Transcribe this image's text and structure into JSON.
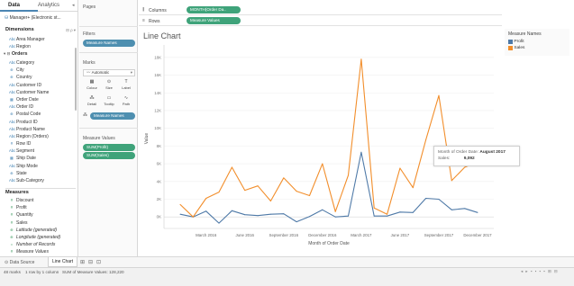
{
  "left_panel": {
    "tabs": [
      {
        "label": "Data"
      },
      {
        "label": "Analytics"
      }
    ],
    "datasource": "Manager+ (Electronic st...",
    "dimensions_title": "Dimensions",
    "dimensions_tools": "⊟ ρ ▾",
    "dimension_fields": [
      {
        "label": "Area Manager",
        "icon": "Abc"
      },
      {
        "label": "Region",
        "icon": "Abc"
      }
    ],
    "orders_label": "Orders",
    "orders_fields": [
      {
        "label": "Category",
        "icon": "Abc"
      },
      {
        "label": "City",
        "icon": "⊕"
      },
      {
        "label": "Country",
        "icon": "⊕"
      },
      {
        "label": "Customer ID",
        "icon": "Abc"
      },
      {
        "label": "Customer Name",
        "icon": "Abc"
      },
      {
        "label": "Order Date",
        "icon": "▦"
      },
      {
        "label": "Order ID",
        "icon": "Abc"
      },
      {
        "label": "Postal Code",
        "icon": "⊕"
      },
      {
        "label": "Product ID",
        "icon": "Abc"
      },
      {
        "label": "Product Name",
        "icon": "Abc"
      },
      {
        "label": "Region (Orders)",
        "icon": "Abc"
      },
      {
        "label": "Row ID",
        "icon": "#"
      },
      {
        "label": "Segment",
        "icon": "Abc"
      },
      {
        "label": "Ship Date",
        "icon": "▦"
      },
      {
        "label": "Ship Mode",
        "icon": "Abc"
      },
      {
        "label": "State",
        "icon": "⊕"
      },
      {
        "label": "Sub-Category",
        "icon": "Abc"
      }
    ],
    "measures_title": "Measures",
    "measure_fields": [
      {
        "label": "Discount",
        "icon": "#"
      },
      {
        "label": "Profit",
        "icon": "#"
      },
      {
        "label": "Quantity",
        "icon": "#"
      },
      {
        "label": "Sales",
        "icon": "#"
      },
      {
        "label": "Latitude (generated)",
        "icon": "⊕"
      },
      {
        "label": "Longitude (generated)",
        "icon": "⊕"
      },
      {
        "label": "Number of Records",
        "icon": "="
      },
      {
        "label": "Measure Values",
        "icon": "#"
      }
    ]
  },
  "pages_card": {
    "title": "Pages"
  },
  "filters_card": {
    "title": "Filters",
    "pill": "Measure Names"
  },
  "marks_card": {
    "title": "Marks",
    "mark_type": "Automatic",
    "buttons": [
      {
        "label": "Colour",
        "glyph": "▦"
      },
      {
        "label": "Size",
        "glyph": "⊙"
      },
      {
        "label": "Label",
        "glyph": "T"
      },
      {
        "label": "Detail",
        "glyph": "⁂"
      },
      {
        "label": "Tooltip",
        "glyph": "▭"
      },
      {
        "label": "Path",
        "glyph": "∿"
      }
    ],
    "color_pill": "Measure Names"
  },
  "measure_values_card": {
    "title": "Measure Values",
    "pills": [
      "SUM(Profit)",
      "SUM(Sales)"
    ]
  },
  "shelves": {
    "columns_label": "Columns",
    "columns_pill": "MONTH(Order Da..",
    "rows_label": "Rows",
    "rows_pill": "Measure Values"
  },
  "chart_data": {
    "type": "line",
    "title": "Line Chart",
    "xlabel": "Month of Order Date",
    "ylabel": "Value",
    "x": [
      "2016-01",
      "2016-02",
      "2016-03",
      "2016-04",
      "2016-05",
      "2016-06",
      "2016-07",
      "2016-08",
      "2016-09",
      "2016-10",
      "2016-11",
      "2016-12",
      "2017-01",
      "2017-02",
      "2017-03",
      "2017-04",
      "2017-05",
      "2017-06",
      "2017-07",
      "2017-08",
      "2017-09",
      "2017-10",
      "2017-11",
      "2017-12"
    ],
    "x_tick_labels": [
      "March 2016",
      "June 2016",
      "September 2016",
      "December 2016",
      "March 2017",
      "June 2017",
      "September 2017",
      "December 2017"
    ],
    "y_ticks": [
      0,
      2000,
      4000,
      6000,
      8000,
      10000,
      12000,
      14000,
      16000,
      18000
    ],
    "y_tick_labels": [
      "0K",
      "2K",
      "4K",
      "6K",
      "8K",
      "10K",
      "12K",
      "14K",
      "16K",
      "18K"
    ],
    "ylim": [
      -1300,
      19000
    ],
    "grid": true,
    "series": [
      {
        "name": "Profit",
        "color": "#4e79a7",
        "values": [
          300,
          0,
          650,
          -700,
          700,
          250,
          150,
          300,
          350,
          -550,
          50,
          800,
          0,
          100,
          7300,
          100,
          100,
          550,
          500,
          2100,
          2000,
          800,
          950,
          500
        ]
      },
      {
        "name": "Sales",
        "color": "#f28e2b",
        "values": [
          1400,
          0,
          2100,
          2800,
          5600,
          3000,
          3500,
          1800,
          4400,
          2900,
          2400,
          6000,
          600,
          4700,
          17800,
          1000,
          300,
          5500,
          3300,
          8700,
          13700,
          4100,
          5600,
          6200
        ]
      }
    ],
    "legend": {
      "title": "Measure Names",
      "position": "right"
    },
    "tooltip": {
      "date_label": "Month of Order Date:",
      "date_value": "August 2017",
      "sales_label": "Sales:",
      "sales_value": "9,092"
    }
  },
  "bottom_tabs": [
    {
      "label": "Data Source",
      "icon": "⊙"
    },
    {
      "label": "Line Chart",
      "icon": ""
    }
  ],
  "bottom_tab_icons": [
    "⊞",
    "⊟",
    "⊡"
  ],
  "status": {
    "marks": "48 marks",
    "rows": "1 row by 1 column",
    "sum": "SUM of Measure Values: 128,220"
  }
}
